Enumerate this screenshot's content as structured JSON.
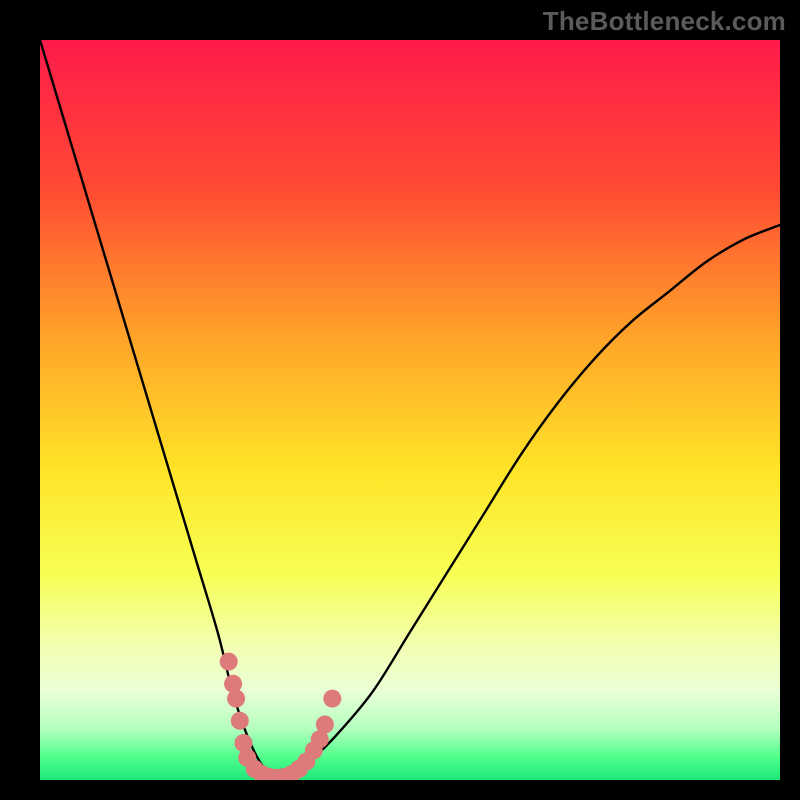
{
  "watermark": {
    "text": "TheBottleneck.com"
  },
  "chart_data": {
    "type": "line",
    "title": "",
    "xlabel": "",
    "ylabel": "",
    "xlim": [
      0,
      100
    ],
    "ylim": [
      0,
      100
    ],
    "gradient_stops": [
      {
        "pos": 0.0,
        "color": "#ff1a4b"
      },
      {
        "pos": 0.2,
        "color": "#ff4a33"
      },
      {
        "pos": 0.4,
        "color": "#ffa329"
      },
      {
        "pos": 0.58,
        "color": "#ffe428"
      },
      {
        "pos": 0.72,
        "color": "#f7ff53"
      },
      {
        "pos": 0.82,
        "color": "#f2ffb2"
      },
      {
        "pos": 0.88,
        "color": "#eaffd6"
      },
      {
        "pos": 0.93,
        "color": "#b6ffc0"
      },
      {
        "pos": 0.97,
        "color": "#4eff8a"
      },
      {
        "pos": 1.0,
        "color": "#1de77a"
      }
    ],
    "series": [
      {
        "name": "bottleneck-curve",
        "x": [
          0,
          3,
          6,
          9,
          12,
          15,
          18,
          21,
          24,
          26,
          28,
          30,
          32,
          34,
          36,
          40,
          45,
          50,
          55,
          60,
          65,
          70,
          75,
          80,
          85,
          90,
          95,
          100
        ],
        "y": [
          100,
          90,
          80,
          70,
          60,
          50,
          40,
          30,
          20,
          12,
          6,
          2,
          0,
          0,
          2,
          6,
          12,
          20,
          28,
          36,
          44,
          51,
          57,
          62,
          66,
          70,
          73,
          75
        ]
      }
    ],
    "highlight_points": {
      "name": "near-minimum-markers",
      "color": "#dd7a7a",
      "points": [
        {
          "x": 25.5,
          "y": 16
        },
        {
          "x": 26.1,
          "y": 13
        },
        {
          "x": 26.5,
          "y": 11
        },
        {
          "x": 27.0,
          "y": 8
        },
        {
          "x": 27.5,
          "y": 5
        },
        {
          "x": 28.0,
          "y": 3
        },
        {
          "x": 29.0,
          "y": 1.5
        },
        {
          "x": 30.0,
          "y": 0.8
        },
        {
          "x": 31.0,
          "y": 0.4
        },
        {
          "x": 32.0,
          "y": 0.3
        },
        {
          "x": 33.0,
          "y": 0.4
        },
        {
          "x": 34.0,
          "y": 0.8
        },
        {
          "x": 35.0,
          "y": 1.5
        },
        {
          "x": 36.0,
          "y": 2.5
        },
        {
          "x": 37.0,
          "y": 4.0
        },
        {
          "x": 37.8,
          "y": 5.5
        },
        {
          "x": 38.5,
          "y": 7.5
        },
        {
          "x": 39.5,
          "y": 11.0
        }
      ]
    }
  }
}
